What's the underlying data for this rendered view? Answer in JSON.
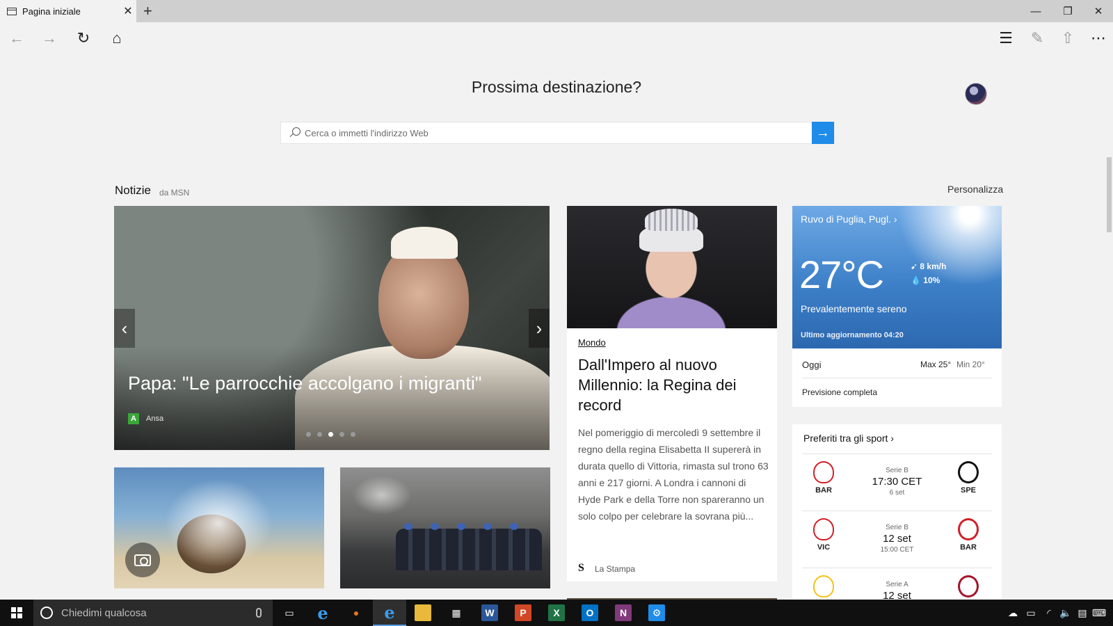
{
  "browser": {
    "tab_title": "Pagina iniziale",
    "tab_close": "✕",
    "new_tab": "+",
    "win_minimize": "—",
    "win_restore": "❐",
    "win_close": "✕",
    "nav": {
      "back": "←",
      "forward": "→",
      "refresh": "↻",
      "home": "⌂",
      "hub": "☰",
      "note": "✎",
      "share": "⇧",
      "more": "⋯"
    }
  },
  "page": {
    "title": "Prossima destinazione?",
    "search_placeholder": "Cerca o immetti l'indirizzo Web",
    "search_go": "→",
    "news_label": "Notizie",
    "news_source": "da MSN",
    "personalize": "Personalizza"
  },
  "carousel": {
    "headline": "Papa: \"Le parrocchie accolgano i migranti\"",
    "source_badge": "A",
    "source": "Ansa",
    "prev": "‹",
    "next": "›",
    "slide_count": 5,
    "active_slide": 3
  },
  "story": {
    "category": "Mondo",
    "title": "Dall'Impero al nuovo Millennio: la Regina dei record",
    "body": "Nel pomeriggio di mercoledì 9 settembre il regno della regina Elisabetta II supererà in durata quello di Vittoria, rimasta sul trono 63 anni e 217 giorni. A Londra i cannoni di Hyde Park e della Torre non spareranno un solo colpo per celebrare la sovrana più...",
    "source_badge": "S",
    "source": "La Stampa"
  },
  "weather": {
    "location": "Ruvo di Puglia, Pugl. ›",
    "temperature": "27°C",
    "wind": "8 km/h",
    "humidity": "10%",
    "condition": "Prevalentemente sereno",
    "updated": "Ultimo aggiornamento 04:20",
    "today_label": "Oggi",
    "max": "Max 25°",
    "min": "Min 20°",
    "full_forecast": "Previsione completa"
  },
  "sports": {
    "header": "Preferiti tra gli sport ›",
    "matches": [
      {
        "home": "BAR",
        "league": "Serie B",
        "time": "17:30 CET",
        "date": "6 set",
        "away": "SPE",
        "home_color": "#d0202a",
        "away_color": "#111111"
      },
      {
        "home": "VIC",
        "league": "Serie B",
        "time": "12 set",
        "date": "15:00 CET",
        "away": "BAR",
        "home_color": "#d0202a",
        "away_color": "#d0202a"
      },
      {
        "home": "",
        "league": "Serie A",
        "time": "12 set",
        "date": "",
        "away": "",
        "home_color": "#f2c21a",
        "away_color": "#a3152a"
      }
    ]
  },
  "taskbar": {
    "search_placeholder": "Chiedimi qualcosa",
    "apps": [
      "task-view",
      "internet-explorer",
      "firefox",
      "edge",
      "file-explorer",
      "store",
      "word",
      "powerpoint",
      "excel",
      "outlook",
      "onenote",
      "settings"
    ],
    "app_letters": {
      "word": "W",
      "powerpoint": "P",
      "excel": "X",
      "outlook": "O",
      "onenote": "N"
    }
  },
  "colors": {
    "accent": "#1e8ce8",
    "weather_blue": "#3d80c8",
    "taskbar": "#101010"
  }
}
